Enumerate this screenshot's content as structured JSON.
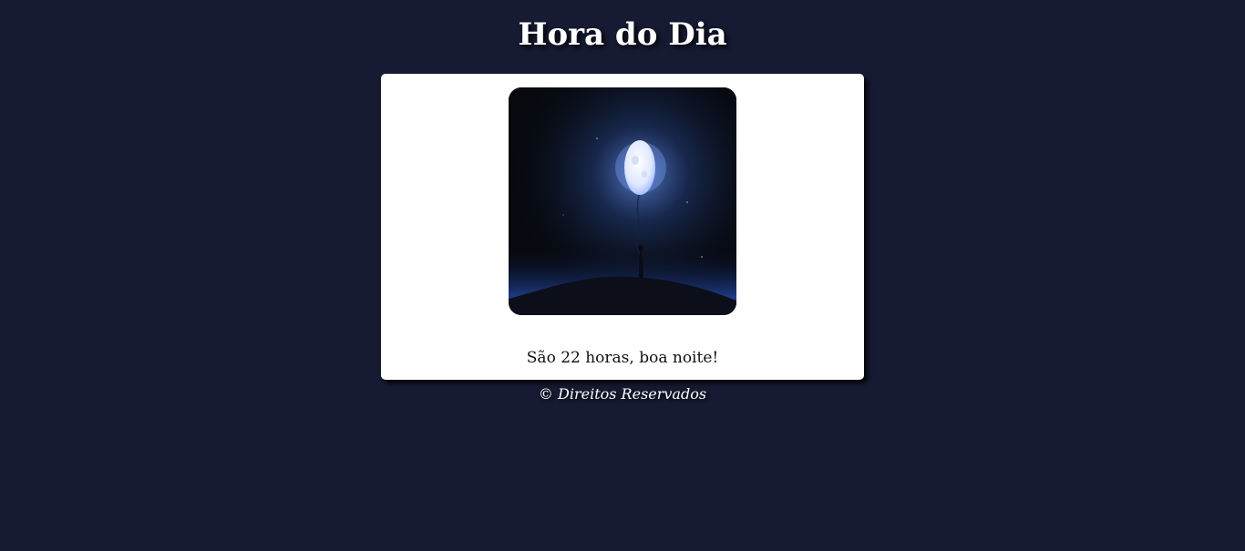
{
  "header": {
    "title": "Hora do Dia"
  },
  "main": {
    "image_subject": "night-moon-balloon",
    "message": "São 22 horas, boa noite!"
  },
  "footer": {
    "text": "© Direitos Reservados"
  },
  "colors": {
    "page_background": "#161b33",
    "card_background": "#ffffff",
    "glow": "#5a8cff"
  }
}
